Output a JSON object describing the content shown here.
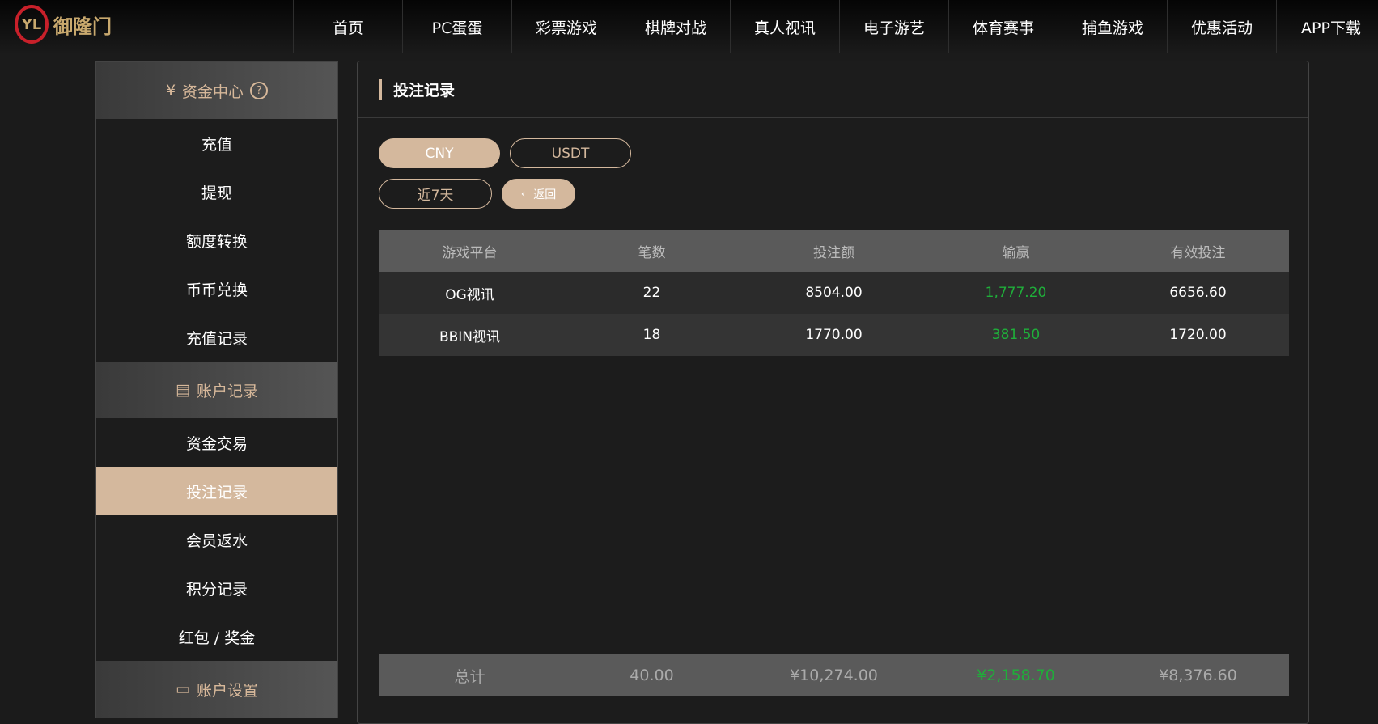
{
  "brand": {
    "name": "御隆门",
    "logo_mark": "YL"
  },
  "nav": [
    "首页",
    "PC蛋蛋",
    "彩票游戏",
    "棋牌对战",
    "真人视讯",
    "电子游艺",
    "体育赛事",
    "捕鱼游戏",
    "优惠活动",
    "APP下载"
  ],
  "sidebar": {
    "section1": {
      "label": "资金中心",
      "icon": "yen-icon",
      "help": "?"
    },
    "items1": [
      "充值",
      "提现",
      "额度转换",
      "币币兑换",
      "充值记录"
    ],
    "section2": {
      "label": "账户记录",
      "icon": "document-icon"
    },
    "items2": [
      "资金交易",
      "投注记录",
      "会员返水",
      "积分记录",
      "红包 / 奖金"
    ],
    "section3": {
      "label": "账户设置",
      "icon": "user-card-icon"
    },
    "active": "投注记录"
  },
  "main": {
    "title": "投注记录",
    "currency": [
      "CNY",
      "USDT"
    ],
    "currency_selected": "CNY",
    "range": "近7天",
    "back": "返回",
    "columns": [
      "游戏平台",
      "笔数",
      "投注额",
      "输赢",
      "有效投注"
    ],
    "rows": [
      {
        "platform": "OG视讯",
        "count": "22",
        "bet": "8504.00",
        "winloss": "1,777.20",
        "valid": "6656.60"
      },
      {
        "platform": "BBIN视讯",
        "count": "18",
        "bet": "1770.00",
        "winloss": "381.50",
        "valid": "1720.00"
      }
    ],
    "total": {
      "label": "总计",
      "count": "40.00",
      "bet": "¥10,274.00",
      "winloss": "¥2,158.70",
      "valid": "¥8,376.60"
    }
  },
  "colors": {
    "accent": "#d4b89d",
    "win": "#1fae3a"
  }
}
